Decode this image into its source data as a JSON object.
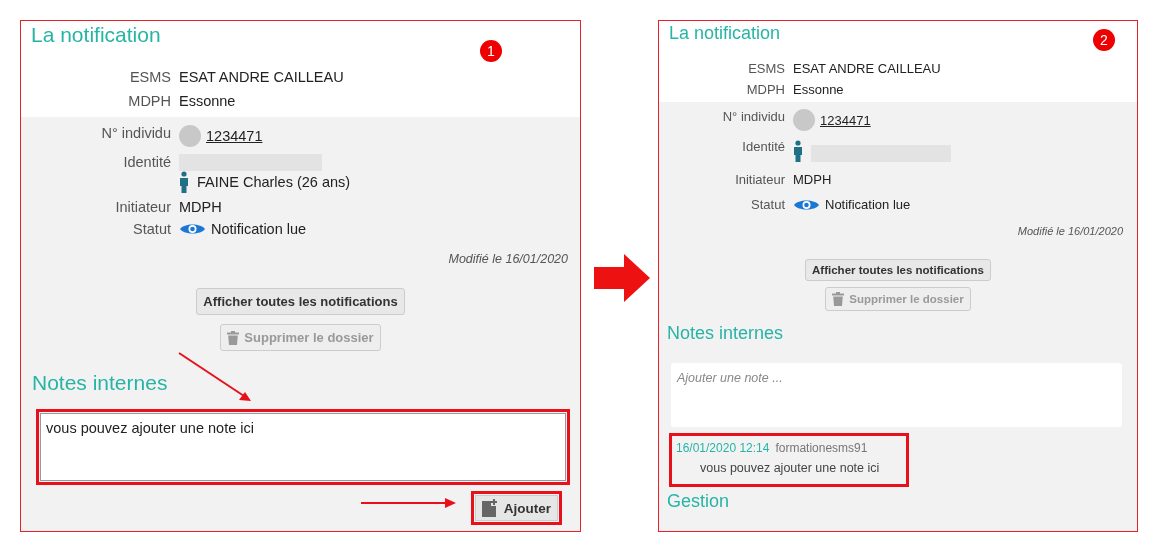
{
  "panels": [
    {
      "step": "1",
      "compact": false,
      "arrows": true,
      "title": "La notification",
      "fields": [
        {
          "label": "ESMS",
          "kind": "text",
          "value": "ESAT ANDRE CAILLEAU",
          "shaded": false
        },
        {
          "label": "MDPH",
          "kind": "text",
          "value": "Essonne",
          "shaded": false
        },
        {
          "label": "N° individu",
          "kind": "link",
          "value": "1234471",
          "shaded": true
        },
        {
          "label": "Identité",
          "kind": "identity",
          "value": "FAINE Charles (26 ans)",
          "shaded": true
        },
        {
          "label": "Initiateur",
          "kind": "text",
          "value": "MDPH",
          "shaded": true
        },
        {
          "label": "Statut",
          "kind": "status",
          "value": "Notification lue",
          "shaded": true
        }
      ],
      "modified": "Modifié le 16/01/2020",
      "buttons": [
        {
          "label": "Afficher toutes les notifications",
          "disabled": false,
          "kind": "plain"
        },
        {
          "label": "Supprimer le dossier",
          "disabled": true,
          "kind": "delete"
        }
      ],
      "notes_title": "Notes internes",
      "note_input": {
        "value": "vous pouvez ajouter une note ici",
        "highlighted": true
      },
      "add_button": {
        "label": "Ajouter",
        "highlighted": true
      }
    },
    {
      "step": "2",
      "compact": true,
      "arrows": false,
      "title": "La notification",
      "fields": [
        {
          "label": "ESMS",
          "kind": "text",
          "value": "ESAT ANDRE CAILLEAU",
          "shaded": false
        },
        {
          "label": "MDPH",
          "kind": "text",
          "value": "Essonne",
          "shaded": false
        },
        {
          "label": "N° individu",
          "kind": "link",
          "value": "1234471",
          "shaded": true
        },
        {
          "label": "Identité",
          "kind": "identity",
          "shaded": true
        },
        {
          "label": "Initiateur",
          "kind": "text",
          "value": "MDPH",
          "shaded": true
        },
        {
          "label": "Statut",
          "kind": "status",
          "value": "Notification lue",
          "shaded": true
        }
      ],
      "modified": "Modifié le 16/01/2020",
      "buttons": [
        {
          "label": "Afficher toutes les notifications",
          "disabled": false,
          "kind": "plain"
        },
        {
          "label": "Supprimer le dossier",
          "disabled": true,
          "kind": "delete"
        }
      ],
      "notes_title": "Notes internes",
      "note_input": {
        "placeholder": "Ajouter une note ...",
        "highlighted": false
      },
      "notes": [
        {
          "timestamp": "16/01/2020 12:14",
          "author": "formationesms91",
          "text": "vous pouvez ajouter une note ici",
          "highlighted": true
        }
      ],
      "section": "Gestion"
    }
  ]
}
